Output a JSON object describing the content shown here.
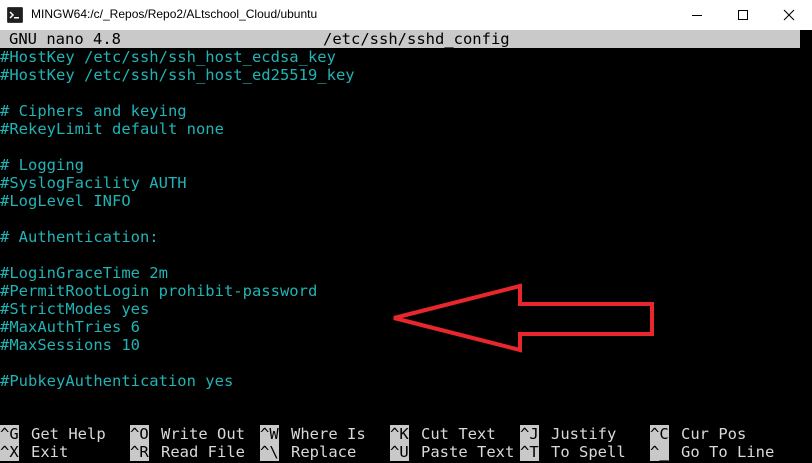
{
  "window": {
    "title": "MINGW64:/c/_Repos/Repo2/ALtschool_Cloud/ubuntu",
    "icon": "mingw-terminal-icon",
    "controls": [
      "minimize-icon",
      "maximize-icon",
      "close-icon"
    ]
  },
  "nano": {
    "version": "GNU nano 4.8",
    "filename": "/etc/ssh/sshd_config"
  },
  "lines": [
    "#HostKey /etc/ssh/ssh_host_ecdsa_key",
    "#HostKey /etc/ssh/ssh_host_ed25519_key",
    "",
    "# Ciphers and keying",
    "#RekeyLimit default none",
    "",
    "# Logging",
    "#SyslogFacility AUTH",
    "#LogLevel INFO",
    "",
    "# Authentication:",
    "",
    "#LoginGraceTime 2m",
    "#PermitRootLogin prohibit-password",
    "#StrictModes yes",
    "#MaxAuthTries 6",
    "#MaxSessions 10",
    "",
    "#PubkeyAuthentication yes"
  ],
  "shortcuts": [
    [
      {
        "key": "^G",
        "label": "Get Help"
      },
      {
        "key": "^O",
        "label": "Write Out"
      },
      {
        "key": "^W",
        "label": "Where Is"
      },
      {
        "key": "^K",
        "label": "Cut Text"
      },
      {
        "key": "^J",
        "label": "Justify"
      },
      {
        "key": "^C",
        "label": "Cur Pos"
      }
    ],
    [
      {
        "key": "^X",
        "label": "Exit"
      },
      {
        "key": "^R",
        "label": "Read File"
      },
      {
        "key": "^\\",
        "label": "Replace"
      },
      {
        "key": "^U",
        "label": "Paste Text"
      },
      {
        "key": "^T",
        "label": "To Spell"
      },
      {
        "key": "^_",
        "label": "Go To Line"
      }
    ]
  ],
  "annotation": {
    "type": "arrow",
    "color": "#e8262e",
    "points_to": "#PermitRootLogin prohibit-password"
  },
  "colors": {
    "text": "#21b3b5",
    "background": "#000000",
    "bar": "#c9c9c9",
    "label": "#d9d9d9"
  }
}
